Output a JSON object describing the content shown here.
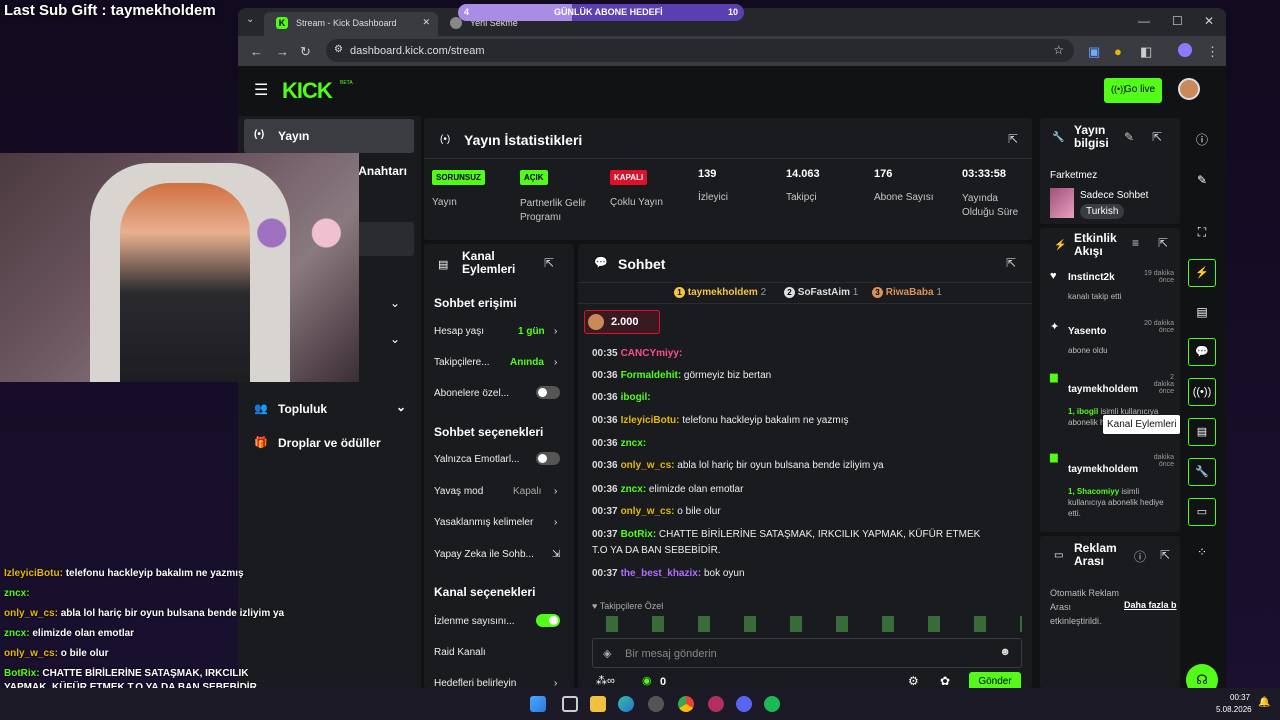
{
  "overlay": {
    "last_sub_gift": "Last Sub Gift : taymekholdem",
    "goal_start": "4",
    "goal_label": "GÜNLÜK ABONE HEDEFİ",
    "goal_end": "10",
    "goal_progress": 0.4,
    "chat": [
      {
        "user": "IzleyiciBotu",
        "text": " telefonu hackleyip bakalım ne yazmış",
        "color": "#e6b800"
      },
      {
        "user": "zncx",
        "text": " ",
        "color": "#53fc18"
      },
      {
        "user": "only_w_cs",
        "text": " abla lol hariç bir oyun bulsana bende izliyim ya",
        "color": "#e6b800"
      },
      {
        "user": "zncx",
        "text": " elimizde olan emotlar",
        "color": "#53fc18"
      },
      {
        "user": "only_w_cs",
        "text": " o bile olur",
        "color": "#e6b800"
      },
      {
        "user": "BotRix",
        "text": " CHATTE BİRİLERİNE SATAŞMAK, IRKCILIK",
        "color": "#53fc18"
      },
      {
        "user": "",
        "text": "YAPMAK, KÜFÜR ETMEK T.O YA DA BAN SEBEBİDİR.",
        "color": "#fff"
      },
      {
        "user": "the_best_khazix",
        "text": " bok oyun",
        "color": "#b06cff"
      }
    ]
  },
  "browser": {
    "tabs": [
      "Stream - Kick Dashboard",
      "Yeni Sekme"
    ],
    "url": "dashboard.kick.com/stream"
  },
  "kick": {
    "logo": "KICK",
    "beta": "BETA",
    "go_live": "Go live",
    "sidebar": [
      "Yayın",
      "ve Anahtarı",
      "Topluluk",
      "Droplar ve ödüller"
    ],
    "stats": {
      "title": "Yayın İstatistikleri",
      "items": [
        {
          "badge": "SORUNSUZ",
          "badge_color": "#53fc18",
          "label": "Yayın"
        },
        {
          "badge": "AÇIK",
          "badge_color": "#53fc18",
          "label": "Partnerlik Gelir Programı"
        },
        {
          "badge": "KAPALI",
          "badge_color": "#e0102a",
          "label": "Çoklu Yayın"
        },
        {
          "value": "139",
          "label": "İzleyici"
        },
        {
          "value": "14.063",
          "label": "Takipçi"
        },
        {
          "value": "176",
          "label": "Abone Sayısı"
        },
        {
          "value": "03:33:58",
          "label": "Yayında Olduğu Süre"
        }
      ]
    },
    "channel_actions": {
      "title": "Kanal Eylemleri",
      "chat_access": "Sohbet erişimi",
      "rows": [
        {
          "label": "Hesap yaşı",
          "value": "1 gün"
        },
        {
          "label": "Takipçilere...",
          "value": "Anında"
        },
        {
          "label": "Abonelere özel..."
        }
      ],
      "chat_options": "Sohbet seçenekleri",
      "rows2": [
        {
          "label": "Yalnızca Emotlarl..."
        },
        {
          "label": "Yavaş mod",
          "value": "Kapalı"
        },
        {
          "label": "Yasaklanmış kelimeler"
        },
        {
          "label": "Yapay Zeka ile Sohb..."
        }
      ],
      "channel_options": "Kanal seçenekleri",
      "rows3": [
        {
          "label": "İzlenme sayısını..."
        },
        {
          "label": "Raid Kanalı"
        },
        {
          "label": "Hedefleri belirleyin"
        }
      ]
    },
    "chat": {
      "title": "Sohbet",
      "top": [
        {
          "rank": "1",
          "name": "taymekholdem",
          "count": "2",
          "color": "#f5c542"
        },
        {
          "rank": "2",
          "name": "SoFastAim",
          "count": "1",
          "color": "#ddd"
        },
        {
          "rank": "3",
          "name": "RiwaBaba",
          "count": "1",
          "color": "#d9925a"
        }
      ],
      "pinned_amount": "2.000",
      "messages": [
        {
          "time": "00:35",
          "user": "CANCYmiyy",
          "text": "",
          "color": "#ff4d8a"
        },
        {
          "time": "00:36",
          "user": "Formaldehit",
          "text": " görmeyiz biz bertan",
          "color": "#53fc18"
        },
        {
          "time": "00:36",
          "user": "ibogil",
          "text": "",
          "color": "#53fc18"
        },
        {
          "time": "00:36",
          "user": "IzleyiciBotu",
          "text": " telefonu hackleyip bakalım ne yazmış",
          "color": "#e6b800"
        },
        {
          "time": "00:36",
          "user": "zncx",
          "text": "",
          "color": "#53fc18"
        },
        {
          "time": "00:36",
          "user": "only_w_cs",
          "text": " abla lol hariç bir oyun bulsana bende izliyim ya",
          "color": "#e6b800"
        },
        {
          "time": "00:36",
          "user": "zncx",
          "text": " elimizde olan emotlar",
          "color": "#53fc18"
        },
        {
          "time": "00:37",
          "user": "only_w_cs",
          "text": " o bile olur",
          "color": "#e6b800"
        },
        {
          "time": "00:37",
          "user": "BotRix",
          "text": " CHATTE BİRİLERİNE SATAŞMAK, IRKCILIK YAPMAK, KÜFÜR ETMEK",
          "color": "#53fc18"
        },
        {
          "time": "",
          "user": "",
          "text": "T.O YA DA BAN SEBEBİDİR.",
          "color": "#fff"
        },
        {
          "time": "00:37",
          "user": "the_best_khazix",
          "text": " bok oyun",
          "color": "#b06cff"
        }
      ],
      "follower_emotes": "Takipçilere Özel",
      "placeholder": "Bir mesaj gönderin",
      "points": "0",
      "send": "Gönder"
    },
    "stream_info": {
      "title": "Yayın bilgisi",
      "stream_title": "Farketmez",
      "category": "Sadece Sohbet",
      "language": "Turkish"
    },
    "activity": {
      "title": "Etkinlik Akışı",
      "items": [
        {
          "name": "Instinct2k",
          "time": "19 dakika önce",
          "desc": "kanalı takip etti"
        },
        {
          "name": "Yasento",
          "time": "20 dakika önce",
          "desc": "abone oldu"
        },
        {
          "name": "taymekholdem",
          "time": "2 dakika önce",
          "desc_hl": "1, ibogil",
          "desc": "isimli kullanıcıya abonelik hediye etti."
        },
        {
          "name": "taymekholdem",
          "time": "dakika önce",
          "desc_hl": "1, Shacomiyy",
          "desc": "isimli kullanıcıya abonelik hediye etti."
        }
      ]
    },
    "ads": {
      "title": "Reklam Arası",
      "text": "Otomatik Reklam Arası etkinleştirildi.",
      "link": "Daha fazla b"
    },
    "tooltip": "Kanal Eylemleri"
  },
  "taskbar": {
    "time": "00:37",
    "date": "5.08.2026"
  }
}
